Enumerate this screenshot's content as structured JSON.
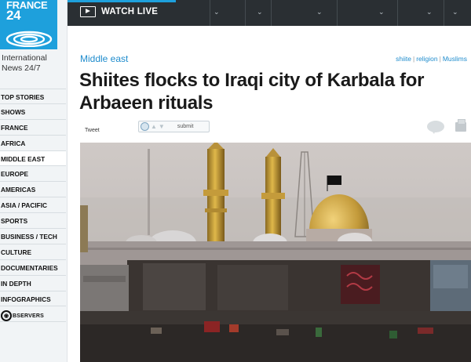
{
  "brand": {
    "logo_line1": "FRANCE",
    "logo_line2": "24",
    "tagline_1": "International",
    "tagline_2": "News 24/7"
  },
  "topbar": {
    "watch_live": "WATCH LIVE",
    "accent_color": "#1ea0dc"
  },
  "sidebar": {
    "items": [
      {
        "label": "TOP STORIES"
      },
      {
        "label": "SHOWS"
      },
      {
        "label": "FRANCE"
      },
      {
        "label": "AFRICA"
      },
      {
        "label": "MIDDLE EAST"
      },
      {
        "label": "EUROPE"
      },
      {
        "label": "AMERICAS"
      },
      {
        "label": "ASIA / PACIFIC"
      },
      {
        "label": "SPORTS"
      },
      {
        "label": "BUSINESS / TECH"
      },
      {
        "label": "CULTURE"
      },
      {
        "label": "DOCUMENTARIES"
      },
      {
        "label": "IN DEPTH"
      },
      {
        "label": "INFOGRAPHICS"
      }
    ],
    "observers_brand": "BSERVERS"
  },
  "article": {
    "category": "Middle east",
    "tags": [
      "shiite",
      "religion",
      "Muslims"
    ],
    "title": "Shiites flocks to Iraqi city of Karbala for Arbaeen rituals",
    "tweet_label": "Tweet",
    "submit_label": "submit"
  }
}
